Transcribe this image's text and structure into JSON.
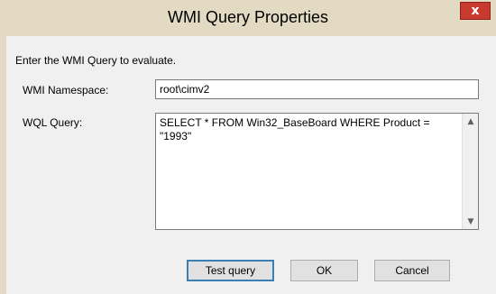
{
  "window": {
    "title": "WMI Query Properties",
    "close_glyph": "x"
  },
  "form": {
    "instruction": "Enter the WMI Query to evaluate.",
    "namespace_label": "WMI Namespace:",
    "namespace_value": "root\\cimv2",
    "query_label": "WQL Query:",
    "query_value": "SELECT * FROM Win32_BaseBoard WHERE Product = \"1993\""
  },
  "scrollbar": {
    "up_glyph": "▲",
    "down_glyph": "▼"
  },
  "buttons": {
    "test_query": "Test query",
    "ok": "OK",
    "cancel": "Cancel"
  },
  "colors": {
    "titlebar": "#e3dac4",
    "close_button": "#c8392e",
    "client_background": "#f0f0f0",
    "default_button_border": "#3c7fb1"
  }
}
